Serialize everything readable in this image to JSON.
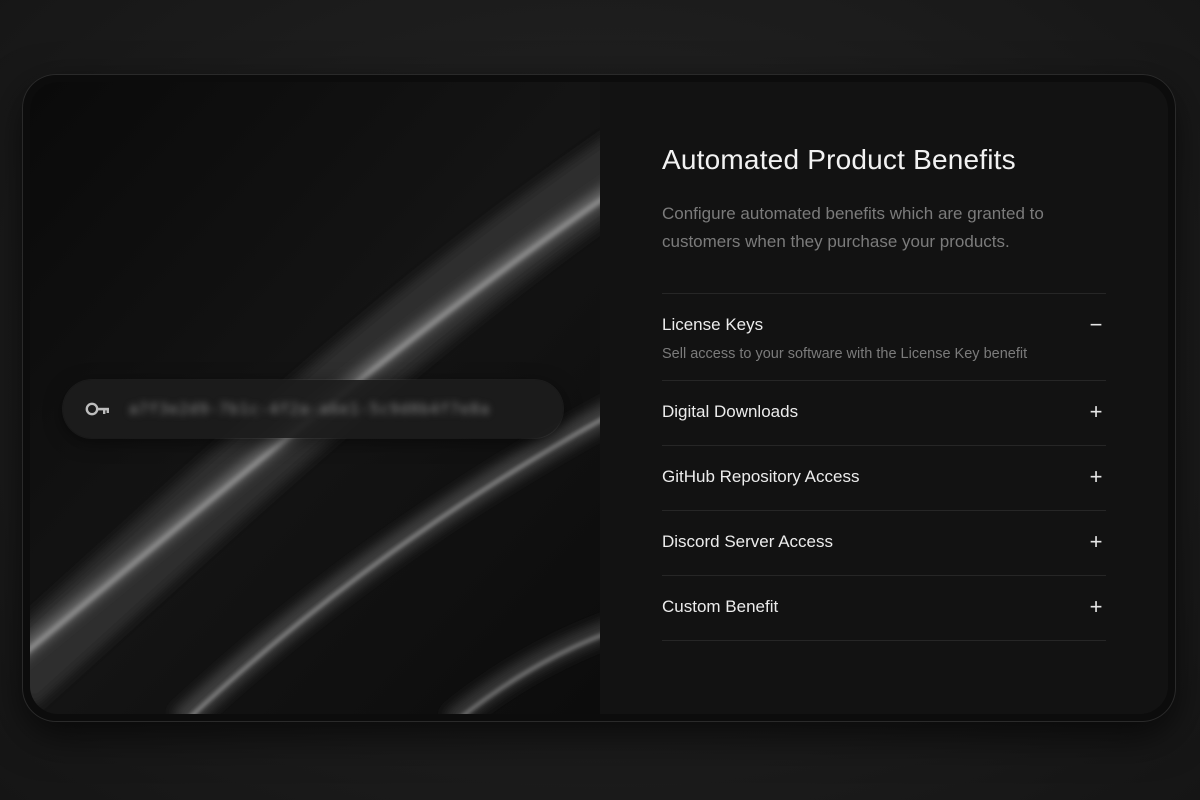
{
  "hero": {
    "key_placeholder_text": "a7f3e2d9-7b1c-4f2a-a6e1-5c9d0b4f7e8a"
  },
  "panel": {
    "title": "Automated Product Benefits",
    "subtitle": "Configure automated benefits which are granted to customers when they purchase your products."
  },
  "benefits": [
    {
      "label": "License Keys",
      "toggle": "−",
      "expanded": true,
      "description": "Sell access to your software with the License Key benefit"
    },
    {
      "label": "Digital Downloads",
      "toggle": "+",
      "expanded": false
    },
    {
      "label": "GitHub Repository Access",
      "toggle": "+",
      "expanded": false
    },
    {
      "label": "Discord Server Access",
      "toggle": "+",
      "expanded": false
    },
    {
      "label": "Custom Benefit",
      "toggle": "+",
      "expanded": false
    }
  ],
  "icons": {
    "key": "key-icon",
    "expand": "plus-icon",
    "collapse": "minus-icon"
  },
  "colors": {
    "background": "#1b1b1b",
    "card": "#111111",
    "text_primary": "#ececec",
    "text_muted": "#7b7b7b",
    "divider": "#262626"
  }
}
